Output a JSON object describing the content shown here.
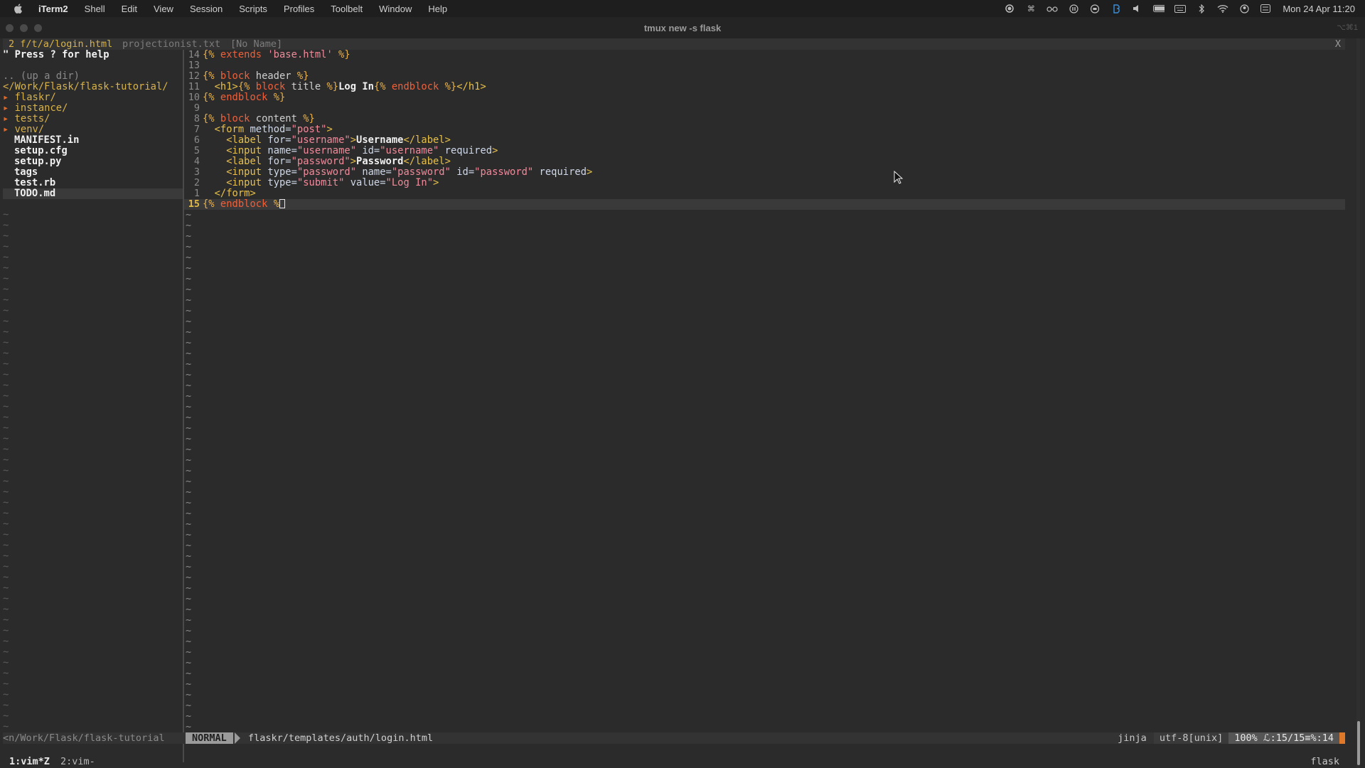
{
  "menubar": {
    "app": "iTerm2",
    "items": [
      "Shell",
      "Edit",
      "View",
      "Session",
      "Scripts",
      "Profiles",
      "Toolbelt",
      "Window",
      "Help"
    ],
    "clock": "Mon 24 Apr  11:20"
  },
  "window": {
    "title": "tmux new -s flask",
    "shortcut": "⌥⌘1"
  },
  "tabline": {
    "active_tab": "2 f/t/a/login.html",
    "tabs": [
      "projectionist.txt",
      "[No Name]"
    ],
    "close": "X"
  },
  "nerdtree": {
    "help": "\" Press ? for help",
    "up": ".. (up a dir)",
    "root": "</Work/Flask/flask-tutorial/",
    "dirs": [
      "flaskr/",
      "instance/",
      "tests/",
      "venv/"
    ],
    "arrow": "▸",
    "files": [
      "MANIFEST.in",
      "setup.cfg",
      "setup.py",
      "tags",
      "test.rb",
      "TODO.md"
    ],
    "tilde": "~"
  },
  "editor": {
    "line_numbers": [
      "14",
      "13",
      "12",
      "11",
      "10",
      "9",
      "8",
      "7",
      "6",
      "5",
      "4",
      "3",
      "2",
      "1",
      "15"
    ],
    "cursor_line": "15",
    "tilde": "~"
  },
  "statusline": {
    "cwd": "<n/Work/Flask/flask-tutorial",
    "mode": "NORMAL",
    "file": "flaskr/templates/auth/login.html",
    "filetype": "jinja",
    "encoding": "utf-8[unix]",
    "position": "100% ℒ:15/15≡%:14"
  },
  "tmux": {
    "window1": "1:vim*Z",
    "window2": "2:vim-",
    "session": "flask"
  }
}
